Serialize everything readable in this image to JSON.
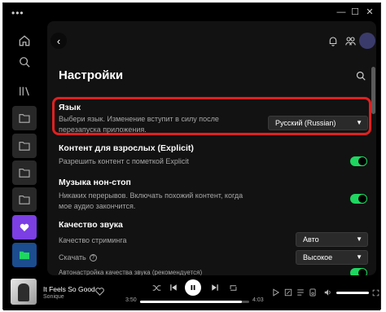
{
  "titlebar": {
    "menu_glyph": "•••",
    "minimize_glyph": "—",
    "maximize_glyph": "☐",
    "close_glyph": "✕"
  },
  "sidebar": {
    "items": [
      {
        "name": "home-icon"
      },
      {
        "name": "search-icon"
      },
      {
        "name": "library-icon"
      },
      {
        "name": "folder-icon"
      },
      {
        "name": "folder-icon"
      },
      {
        "name": "folder-icon"
      },
      {
        "name": "folder-icon"
      },
      {
        "name": "liked-songs-tile",
        "color": "#7b3fe4"
      },
      {
        "name": "playlist-tile",
        "color": "#1b4d8f"
      }
    ]
  },
  "header": {
    "back_glyph": "‹",
    "title": "Настройки"
  },
  "sections": {
    "language": {
      "title": "Язык",
      "description": "Выбери язык. Изменение вступит в силу после перезапуска приложения.",
      "selected": "Русский (Russian)"
    },
    "explicit": {
      "title": "Контент для взрослых (Explicit)",
      "description": "Разрешить контент с пометкой Explicit",
      "enabled": true
    },
    "autoplay": {
      "title": "Музыка нон-стоп",
      "description": "Никаких перерывов. Включать похожий контент, когда мое аудио закончится.",
      "enabled": true
    },
    "quality": {
      "title": "Качество звука",
      "streaming_label": "Качество стриминга",
      "streaming_value": "Авто",
      "download_label": "Скачать",
      "download_value": "Высокое",
      "auto_label": "Автонастройка качества звука (рекомендуется)"
    }
  },
  "player": {
    "track_title": "It Feels So Good",
    "track_artist": "Sonique",
    "elapsed": "3:50",
    "duration": "4:03",
    "progress_fraction": 0.93
  },
  "colors": {
    "accent": "#1ed760",
    "highlight": "#e02020",
    "panel": "#121212"
  }
}
